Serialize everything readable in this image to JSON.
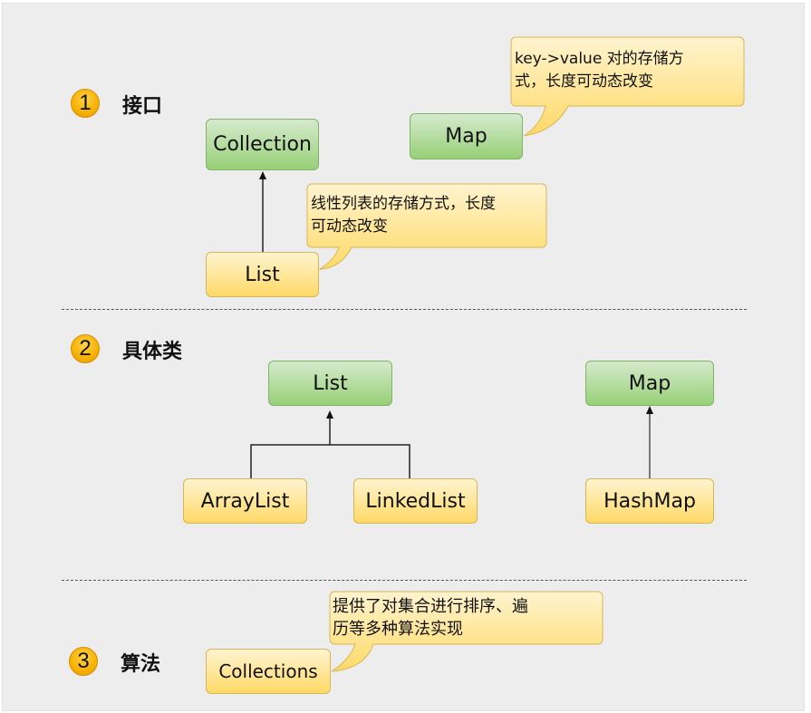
{
  "sections": [
    {
      "number": "1",
      "title": "接口"
    },
    {
      "number": "2",
      "title": "具体类"
    },
    {
      "number": "3",
      "title": "算法"
    }
  ],
  "interfaces": {
    "collection": "Collection",
    "list": "List",
    "map": "Map",
    "list_note": "线性列表的存储方式，长度\n可动态改变",
    "map_note": "key->value 对的存储方\n式，长度可动态改变"
  },
  "classes": {
    "list": "List",
    "arraylist": "ArrayList",
    "linkedlist": "LinkedList",
    "map": "Map",
    "hashmap": "HashMap"
  },
  "algorithms": {
    "collections": "Collections",
    "collections_note": "提供了对集合进行排序、遍\n历等多种算法实现"
  },
  "colors": {
    "interface_fill": "#97d077",
    "interface_border": "#82b366",
    "class_fill": "#ffd966",
    "class_border": "#d6b656",
    "badge": "#f6b100"
  }
}
